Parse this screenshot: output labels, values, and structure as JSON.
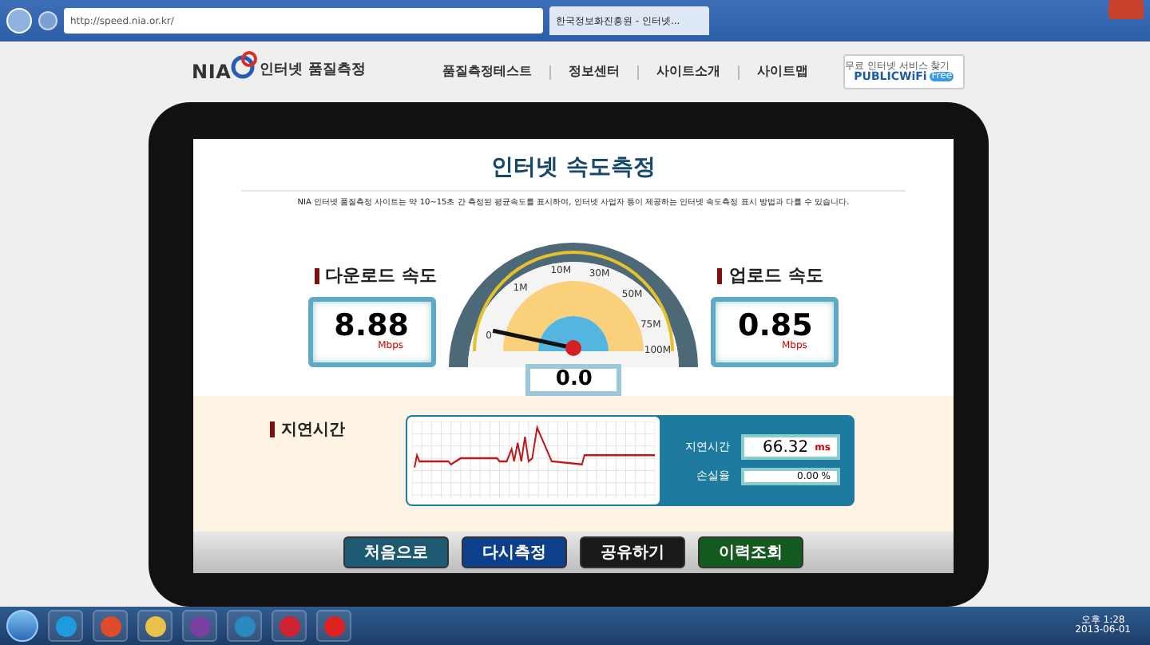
{
  "browser": {
    "address": "http://speed.nia.or.kr/",
    "tab_title": "한국정보화진흥원 - 인터넷..."
  },
  "header": {
    "logo": "NIA",
    "site_name": "인터넷 품질측정",
    "nav": [
      "품질측정테스트",
      "정보센터",
      "사이트소개",
      "사이트맵"
    ],
    "wifi_badge": {
      "caption": "무료 인터넷 서비스 찾기",
      "label": "PUBLICWiFi",
      "tag": "Free"
    }
  },
  "main": {
    "title": "인터넷 속도측정",
    "notice": "NIA 인터넷 품질측정 사이트는 약 10~15초 간 측정된 평균속도를 표시하여, 인터넷 사업자 등이 제공하는 인터넷 속도측정 표시 방법과 다를 수 있습니다.",
    "download": {
      "label": "다운로드 속도",
      "value": "8.88",
      "unit": "Mbps"
    },
    "upload": {
      "label": "업로드 속도",
      "value": "0.85",
      "unit": "Mbps"
    },
    "gauge": {
      "ticks": [
        "0",
        "1M",
        "10M",
        "30M",
        "50M",
        "75M",
        "100M"
      ],
      "reading": "0.0"
    },
    "latency": {
      "label": "지연시간",
      "fields": [
        {
          "label": "지연시간",
          "value": "66.32",
          "unit": "ms"
        },
        {
          "label": "손실율",
          "value": "0.00 %"
        }
      ]
    },
    "buttons": [
      {
        "label": "처음으로",
        "color": "#1d5a72"
      },
      {
        "label": "다시측정",
        "color": "#0d3f8a"
      },
      {
        "label": "공유하기",
        "color": "#1a1a1a"
      },
      {
        "label": "이력조회",
        "color": "#135a1e"
      }
    ]
  },
  "taskbar": {
    "time": "오후 1:28",
    "date": "2013-06-01"
  }
}
